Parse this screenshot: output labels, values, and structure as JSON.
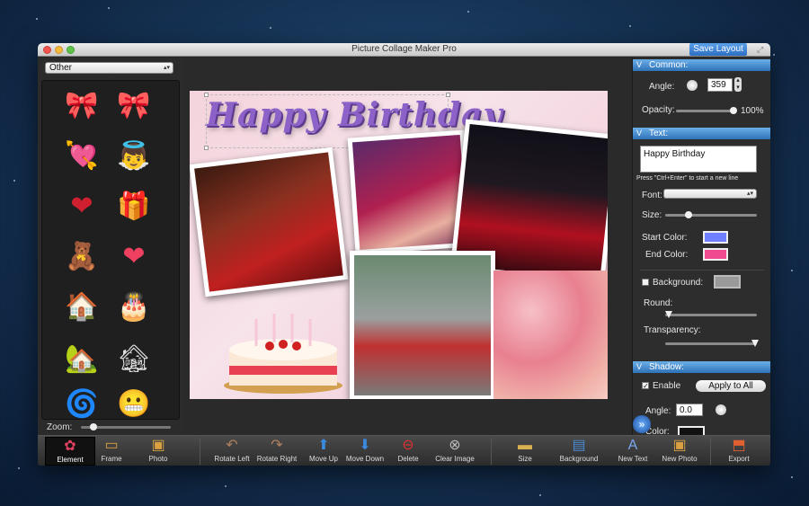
{
  "window": {
    "title": "Picture Collage Maker Pro",
    "save_layout": "Save Layout"
  },
  "left_panel": {
    "category": "Other",
    "elements": [
      {
        "name": "bow-icon",
        "glyph": "🎀"
      },
      {
        "name": "red-bow-icon",
        "glyph": "🎀"
      },
      {
        "name": "heart-arrow-icon",
        "glyph": "💘"
      },
      {
        "name": "cupid-icon",
        "glyph": "👼"
      },
      {
        "name": "winged-heart-icon",
        "glyph": "❤"
      },
      {
        "name": "gift-icon",
        "glyph": "🎁"
      },
      {
        "name": "teddy-bear-icon",
        "glyph": "🧸"
      },
      {
        "name": "heart-icon",
        "glyph": "❤"
      },
      {
        "name": "house-icon",
        "glyph": "🏠"
      },
      {
        "name": "cake-icon",
        "glyph": "🎂"
      },
      {
        "name": "red-house-icon",
        "glyph": "🏡"
      },
      {
        "name": "gray-house-icon",
        "glyph": "🏚"
      },
      {
        "name": "windmill-icon",
        "glyph": "🌀"
      },
      {
        "name": "smiley-icon",
        "glyph": "😬"
      }
    ],
    "zoom_label": "Zoom:"
  },
  "canvas": {
    "title_text": "Happy Birthday"
  },
  "common": {
    "header": "Common:",
    "angle_label": "Angle:",
    "angle_value": "359",
    "opacity_label": "Opacity:",
    "opacity_value": "100%"
  },
  "text": {
    "header": "Text:",
    "content": "Happy Birthday",
    "hint": "Press \"Ctrl+Enter\" to start a new line",
    "font_label": "Font:",
    "size_label": "Size:",
    "start_color_label": "Start Color:",
    "end_color_label": "End Color:",
    "start_color": "#6f7fff",
    "end_color": "#f04a90",
    "background_label": "Background:",
    "round_label": "Round:",
    "transparency_label": "Transparency:"
  },
  "shadow": {
    "header": "Shadow:",
    "enable_label": "Enable",
    "apply_all": "Apply to All",
    "angle_label": "Angle:",
    "angle_value": "0.0",
    "color_label": "Color:"
  },
  "toolbar": {
    "element": "Element",
    "frame": "Frame",
    "photo": "Photo",
    "rotate_left": "Rotate Left",
    "rotate_right": "Rotate Right",
    "move_up": "Move Up",
    "move_down": "Move Down",
    "delete": "Delete",
    "clear_image": "Clear Image",
    "size": "Size",
    "background": "Background",
    "new_text": "New Text",
    "new_photo": "New Photo",
    "export": "Export"
  }
}
